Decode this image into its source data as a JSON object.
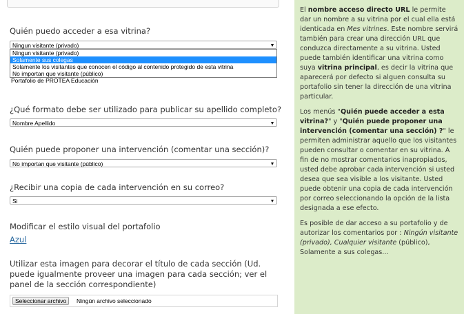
{
  "form": {
    "access_question": "Quién puedo acceder a esa vitrina?",
    "access_select_value": "Ningun visitante (privado)",
    "access_options": [
      "Ningun visitante (privado)",
      "Solamente sus colegas",
      "Solamente los visitantes que conocen el código al contenido protegido de esta vitrina",
      "No importan que visitante (público)"
    ],
    "underlay_text": "Portafolio de PROTEA Educación",
    "format_question": "¿Qué formato debe ser utilizado para publicar su apellido completo?",
    "format_value": "Nombre Apellido",
    "propose_question": "Quién puede proponer una intervención (comentar una sección)?",
    "propose_value": "No importan que visitante (público)",
    "copy_question": "¿Recibir una copia de cada intervención en su correo?",
    "copy_value": "Si",
    "style_label": "Modificar el estilo visual del portafolio",
    "style_link": "Azul",
    "image_label": "Utilizar esta imagen para decorar el título de cada sección (Ud. puede igualmente proveer una imagen para cada sección; ver el panel de la sección correspondiente)",
    "file_button": "Seleccionar archivo",
    "file_status": "Ningún archivo seleccionado"
  },
  "help": {
    "p1_a": "El ",
    "p1_b": "nombre acceso directo URL",
    "p1_c": " le permite dar un nombre a su vitrina por el cual ella está identicada en ",
    "p1_d": "Mes vitrines",
    "p1_e": ". Este nombre servirá también para crear una dirección URL que conduzca directamente a su vitrina. Usted puede también identificar una vitrina como suya ",
    "p1_f": "vitrina principal",
    "p1_g": ", es decir la vitrina que aparecerá por defecto si alguen consulta su portafolio sin tener la dirección de una vitrina particular.",
    "p2_a": "Los menús \"",
    "p2_b": "Quién puede acceder a esta vitrina?",
    "p2_c": "\" y \"",
    "p2_d": "Quién puede proponer una intervención (comentar una sección) ?",
    "p2_e": "\" le permiten administrar aquello que los visitantes pueden consultar o comentar en su vitrina. A fin de no mostrar comentarios inapropiados, usted debe aprobar cada intervención si usted desea que sea visible a los visitante. Usted puede obtenir una copia de cada intervención por correo seleccionando la opción de la lista designada a ese efecto.",
    "p3_a": "Es posible de dar acceso a su portafolio y de autorizar los comentarios por : ",
    "p3_b": "Ningún visitante (privado), Cualquier visitante",
    "p3_c": " (público), Solamente a sus colegas..."
  }
}
